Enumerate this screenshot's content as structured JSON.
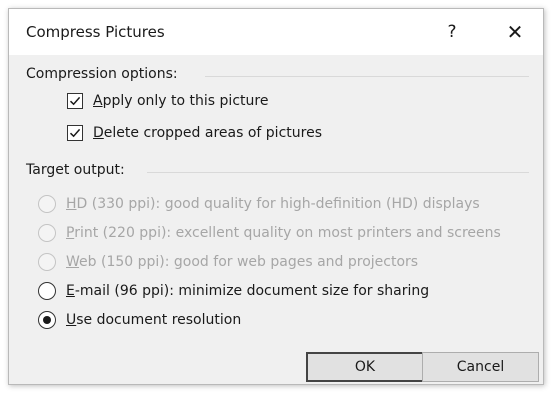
{
  "dialog": {
    "title": "Compress Pictures",
    "help_symbol": "?",
    "close_symbol": "✕"
  },
  "compression": {
    "heading": "Compression options:",
    "options": [
      {
        "mnemonic": "A",
        "rest": "pply only to this picture",
        "checked": true
      },
      {
        "mnemonic": "D",
        "rest": "elete cropped areas of pictures",
        "checked": true
      }
    ]
  },
  "target": {
    "heading": "Target output:",
    "options": [
      {
        "mnemonic": "H",
        "rest": "D (330 ppi): good quality for high-definition (HD) displays",
        "enabled": false,
        "selected": false
      },
      {
        "mnemonic": "P",
        "rest": "rint (220 ppi): excellent quality on most printers and screens",
        "enabled": false,
        "selected": false
      },
      {
        "mnemonic": "W",
        "rest": "eb (150 ppi): good for web pages and projectors",
        "enabled": false,
        "selected": false
      },
      {
        "mnemonic": "E",
        "rest": "-mail (96 ppi): minimize document size for sharing",
        "enabled": true,
        "selected": false
      },
      {
        "mnemonic": "U",
        "rest": "se document resolution",
        "enabled": true,
        "selected": true
      }
    ]
  },
  "buttons": {
    "ok": "OK",
    "cancel": "Cancel"
  },
  "colors": {
    "dialog_bg": "#f0f0f0",
    "disabled_text": "#a6a6a6",
    "button_bg": "#e1e1e1"
  }
}
